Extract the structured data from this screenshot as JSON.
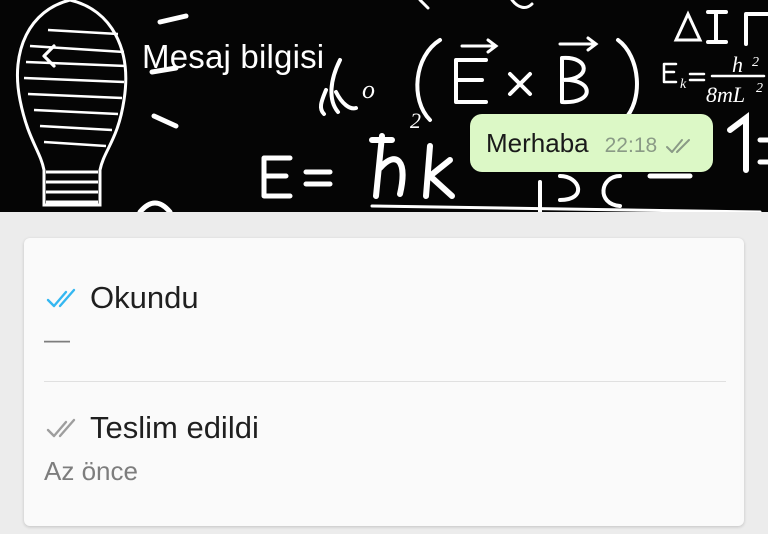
{
  "header": {
    "title": "Mesaj bilgisi",
    "back_icon": "arrow-back-icon"
  },
  "message": {
    "text": "Merhaba",
    "time": "22:18",
    "status_icon": "double-check-icon"
  },
  "receipts": [
    {
      "status_label": "Okundu",
      "icon": "double-check-blue-icon",
      "icon_color": "#34b7f1",
      "detail": "—"
    },
    {
      "status_label": "Teslim edildi",
      "icon": "double-check-gray-icon",
      "icon_color": "#9e9e9e",
      "detail": "Az önce"
    }
  ],
  "colors": {
    "header_bg": "#050505",
    "bubble_bg": "#dcf8c6",
    "page_bg": "#ececec"
  }
}
